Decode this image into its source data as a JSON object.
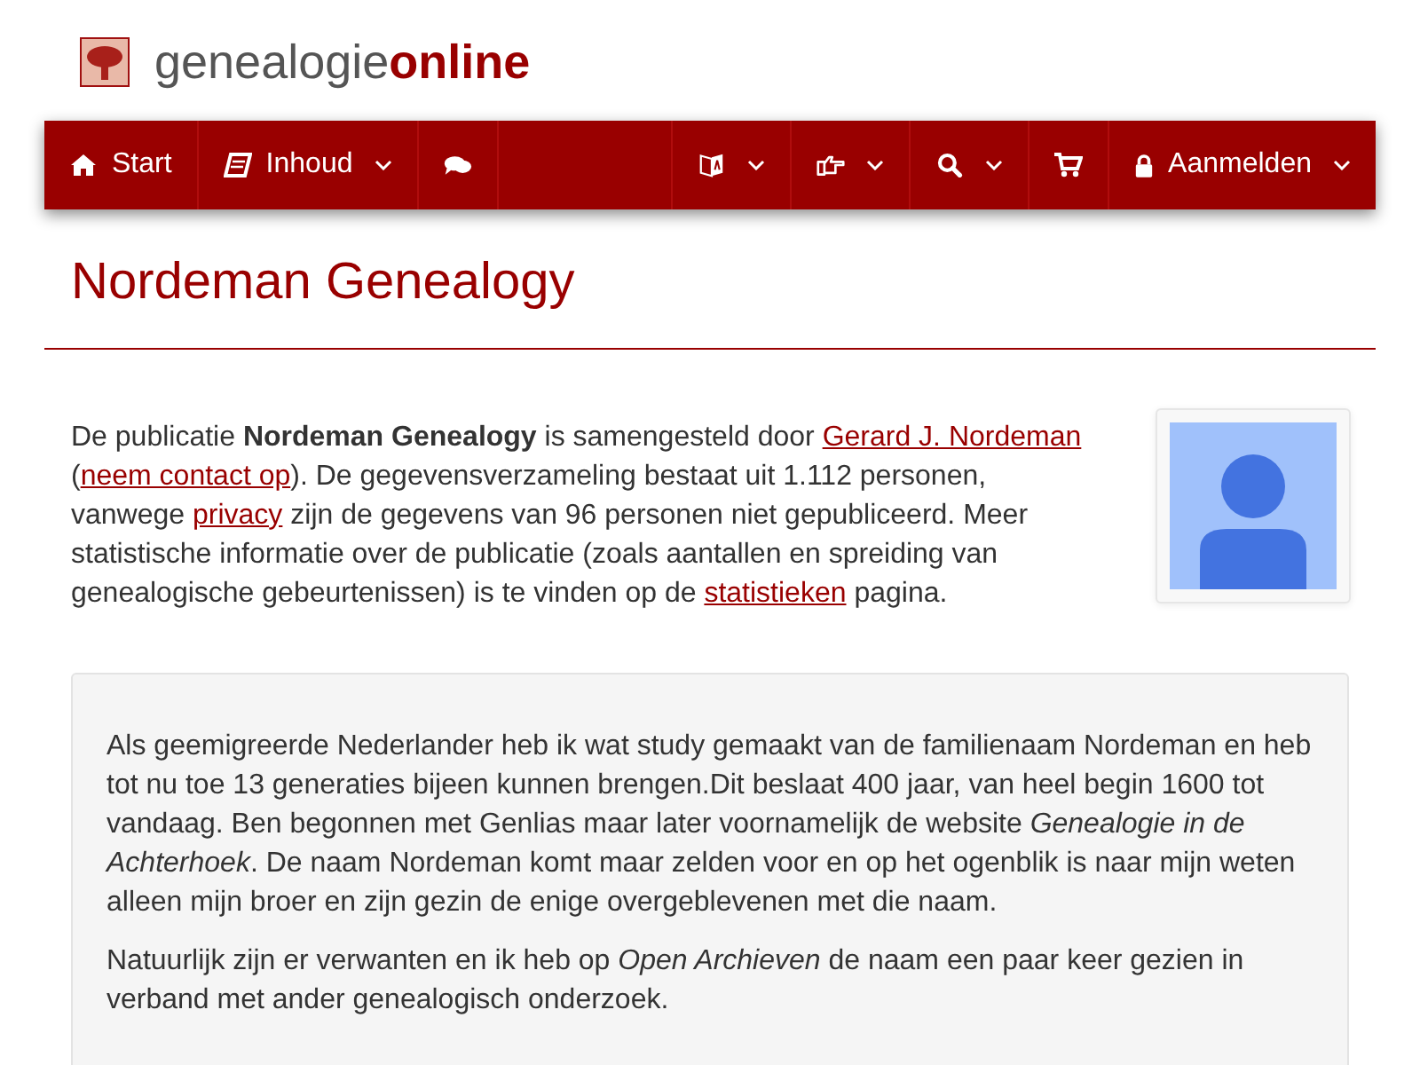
{
  "logo": {
    "text_regular": "genealogie",
    "text_bold": "online"
  },
  "nav": {
    "left": [
      {
        "label": "Start",
        "has_menu": false
      },
      {
        "label": "Inhoud",
        "has_menu": true
      },
      {
        "has_menu": false
      }
    ],
    "right": [
      {
        "has_menu": true
      },
      {
        "has_menu": true
      },
      {
        "has_menu": true
      },
      {
        "has_menu": false
      },
      {
        "label": "Aanmelden",
        "has_menu": true
      }
    ]
  },
  "title": "Nordeman Genealogy",
  "intro": [
    {
      "kind": "text",
      "text": "De publicatie **Nordeman Genealogy** is samengesteld door "
    },
    {
      "kind": "link",
      "text": "Gerard J. Nordeman"
    },
    {
      "kind": "text",
      "text": " ("
    },
    {
      "kind": "link",
      "text": "neem contact op"
    },
    {
      "kind": "text",
      "text": "). De gegevensverzameling bestaat uit 1.112 personen, vanwege "
    },
    {
      "kind": "link",
      "text": "privacy"
    },
    {
      "kind": "text",
      "text": " zijn de gegevens van 96 personen niet gepubliceerd. Meer statistische informatie over de publicatie (zoals aantallen en spreiding van genealogische gebeurtenissen) is te vinden op de "
    },
    {
      "kind": "link",
      "text": "statistieken"
    },
    {
      "kind": "text",
      "text": " pagina."
    }
  ],
  "description": [
    "Als geemigreerde Nederlander heb ik wat study gemaakt van de familienaam Nordeman en heb tot nu toe 13 generaties bijeen kunnen brengen.Dit beslaat 400 jaar, van heel begin 1600 tot vandaag. Ben begonnen met Genlias maar later voornamelijk de website *Genealogie in de Achterhoek*. De naam Nordeman komt maar zelden voor en op het ogenblik is naar mijn weten alleen mijn broer en zijn gezin de enige overgeblevenen met die naam.",
    "Natuurlijk zijn er verwanten en ik heb op *Open Archieven* de naam een paar keer gezien in verband met ander genealogisch onderzoek."
  ]
}
